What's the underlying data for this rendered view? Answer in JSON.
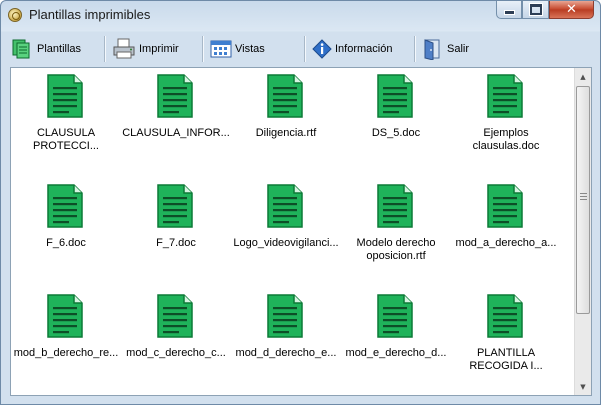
{
  "window": {
    "title": "Plantillas imprimibles"
  },
  "toolbar": {
    "plantillas": "Plantillas",
    "imprimir": "Imprimir",
    "vistas": "Vistas",
    "informacion": "Información",
    "salir": "Salir"
  },
  "files": [
    {
      "line1": "CLAUSULA",
      "line2": "PROTECCI..."
    },
    {
      "line1": "CLAUSULA_INFOR...",
      "line2": ""
    },
    {
      "line1": "Diligencia.rtf",
      "line2": ""
    },
    {
      "line1": "DS_5.doc",
      "line2": ""
    },
    {
      "line1": "Ejemplos",
      "line2": "clausulas.doc"
    },
    {
      "line1": "F_6.doc",
      "line2": ""
    },
    {
      "line1": "F_7.doc",
      "line2": ""
    },
    {
      "line1": "Logo_videovigilanci...",
      "line2": ""
    },
    {
      "line1": "Modelo derecho",
      "line2": "oposicion.rtf"
    },
    {
      "line1": "mod_a_derecho_a...",
      "line2": ""
    },
    {
      "line1": "mod_b_derecho_re...",
      "line2": ""
    },
    {
      "line1": "mod_c_derecho_c...",
      "line2": ""
    },
    {
      "line1": "mod_d_derecho_e...",
      "line2": ""
    },
    {
      "line1": "mod_e_derecho_d...",
      "line2": ""
    },
    {
      "line1": "PLANTILLA",
      "line2": "RECOGIDA I..."
    }
  ],
  "colors": {
    "doc_green": "#1fb35a",
    "doc_dark": "#0c7a36",
    "close_red": "#c5452a"
  }
}
